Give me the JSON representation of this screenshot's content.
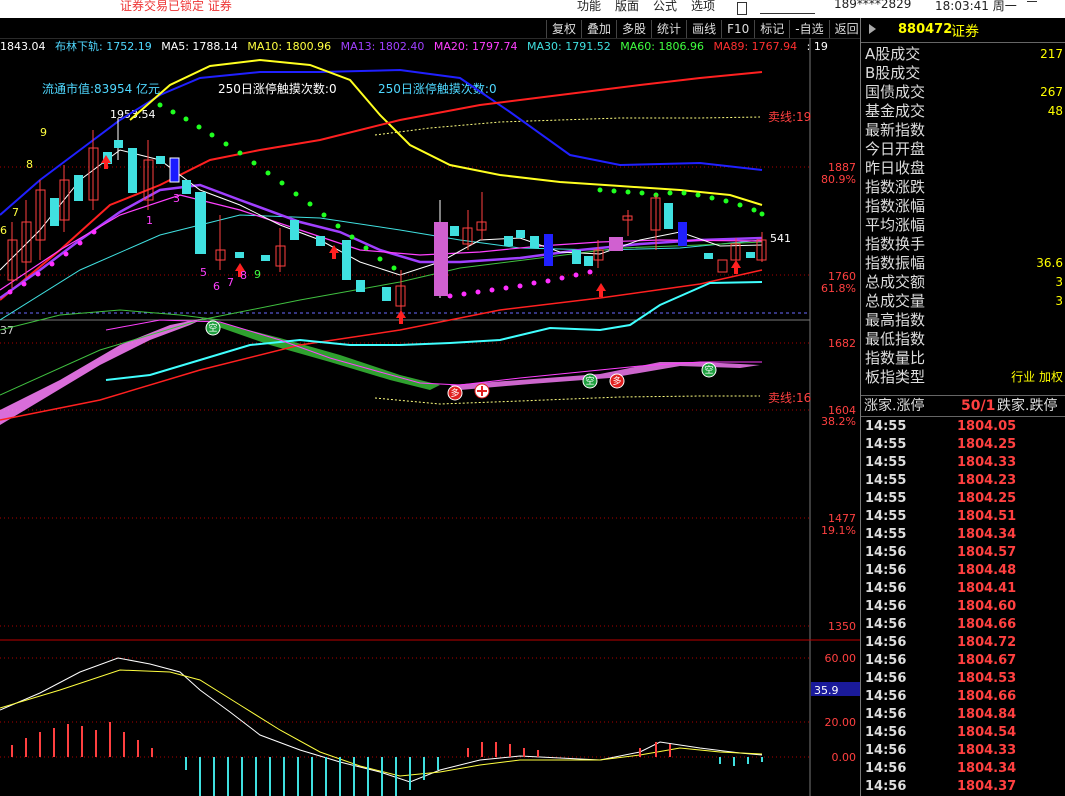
{
  "topbar": {
    "warning": "证券交易已锁定  证券",
    "menu": [
      "功能",
      "版面",
      "公式",
      "选项"
    ],
    "phone": "189****2829",
    "clock": "18:03:41 周一"
  },
  "toolbar": [
    "复权",
    "叠加",
    "多股",
    "统计",
    "画线",
    "F10",
    "标记",
    "-自选",
    "返回"
  ],
  "indicators": [
    {
      "t": "1843.04",
      "c": "#ffffff"
    },
    {
      "t": "布林下轨: 1752.19",
      "c": "#4fd8ff"
    },
    {
      "t": "MA5: 1788.14",
      "c": "#ffffff"
    },
    {
      "t": "MA10: 1800.96",
      "c": "#ffff40"
    },
    {
      "t": "MA13: 1802.40",
      "c": "#a040ff"
    },
    {
      "t": "MA20: 1797.74",
      "c": "#ff40ff"
    },
    {
      "t": "MA30: 1791.52",
      "c": "#40e0e0"
    },
    {
      "t": "MA60: 1806.96",
      "c": "#40ff40"
    },
    {
      "t": "MA89: 1767.94",
      "c": "#ff3030"
    },
    {
      "t": ": 19",
      "c": "#ffffff"
    }
  ],
  "chart": {
    "annot_cap": "流通市值:83954 亿元",
    "annot_250a": "250日涨停触摸次数:0",
    "annot_250b": "250日涨停触摸次数:0",
    "high_label": "1953.54",
    "sell_top": "卖线:19",
    "sell_bottom": "卖线:16",
    "cur_price": "541",
    "left_edge": "37",
    "y_labels": [
      "1887",
      "1760",
      "1682",
      "1604",
      "1477",
      "1350"
    ],
    "pct_labels": [
      "80.9%",
      "61.8%",
      "38.2%",
      "19.1%"
    ],
    "sub_labels": [
      "60.00",
      "20.00",
      "0.00"
    ],
    "sub_value": "35.9",
    "digits_left": [
      "9",
      "8",
      "7",
      "6"
    ],
    "digits_seq": [
      "1",
      "3",
      "5",
      "6",
      "7",
      "8",
      "9"
    ],
    "chip_labels": [
      "空",
      "多",
      "空",
      "多",
      "空"
    ]
  },
  "right_panel": {
    "code": "880472",
    "name": "证券",
    "stats": [
      {
        "label": "A股成交",
        "value": "217"
      },
      {
        "label": "B股成交",
        "value": ""
      },
      {
        "label": "国债成交",
        "value": "267"
      },
      {
        "label": "基金成交",
        "value": "48"
      },
      {
        "label": "最新指数",
        "value": ""
      },
      {
        "label": "今日开盘",
        "value": ""
      },
      {
        "label": "昨日收盘",
        "value": ""
      },
      {
        "label": "指数涨跌",
        "value": ""
      },
      {
        "label": "指数涨幅",
        "value": ""
      },
      {
        "label": "平均涨幅",
        "value": ""
      },
      {
        "label": "指数换手",
        "value": ""
      },
      {
        "label": "指数振幅",
        "value": "36.6"
      },
      {
        "label": "总成交额",
        "value": "3"
      },
      {
        "label": "总成交量",
        "value": "3"
      },
      {
        "label": "最高指数",
        "value": ""
      },
      {
        "label": "最低指数",
        "value": ""
      },
      {
        "label": "指数量比",
        "value": ""
      },
      {
        "label": "板指类型",
        "value": "行业 加权"
      }
    ],
    "tabs": {
      "a": "涨家.涨停",
      "b": "50/1",
      "c": "跌家.跌停"
    },
    "ticks": [
      [
        "14:55",
        "1804.05"
      ],
      [
        "14:55",
        "1804.25"
      ],
      [
        "14:55",
        "1804.33"
      ],
      [
        "14:55",
        "1804.23"
      ],
      [
        "14:55",
        "1804.25"
      ],
      [
        "14:55",
        "1804.51"
      ],
      [
        "14:55",
        "1804.34"
      ],
      [
        "14:56",
        "1804.57"
      ],
      [
        "14:56",
        "1804.48"
      ],
      [
        "14:56",
        "1804.41"
      ],
      [
        "14:56",
        "1804.60"
      ],
      [
        "14:56",
        "1804.66"
      ],
      [
        "14:56",
        "1804.72"
      ],
      [
        "14:56",
        "1804.67"
      ],
      [
        "14:56",
        "1804.53"
      ],
      [
        "14:56",
        "1804.66"
      ],
      [
        "14:56",
        "1804.84"
      ],
      [
        "14:56",
        "1804.54"
      ],
      [
        "14:56",
        "1804.33"
      ],
      [
        "14:56",
        "1804.34"
      ],
      [
        "14:56",
        "1804.37"
      ]
    ]
  }
}
